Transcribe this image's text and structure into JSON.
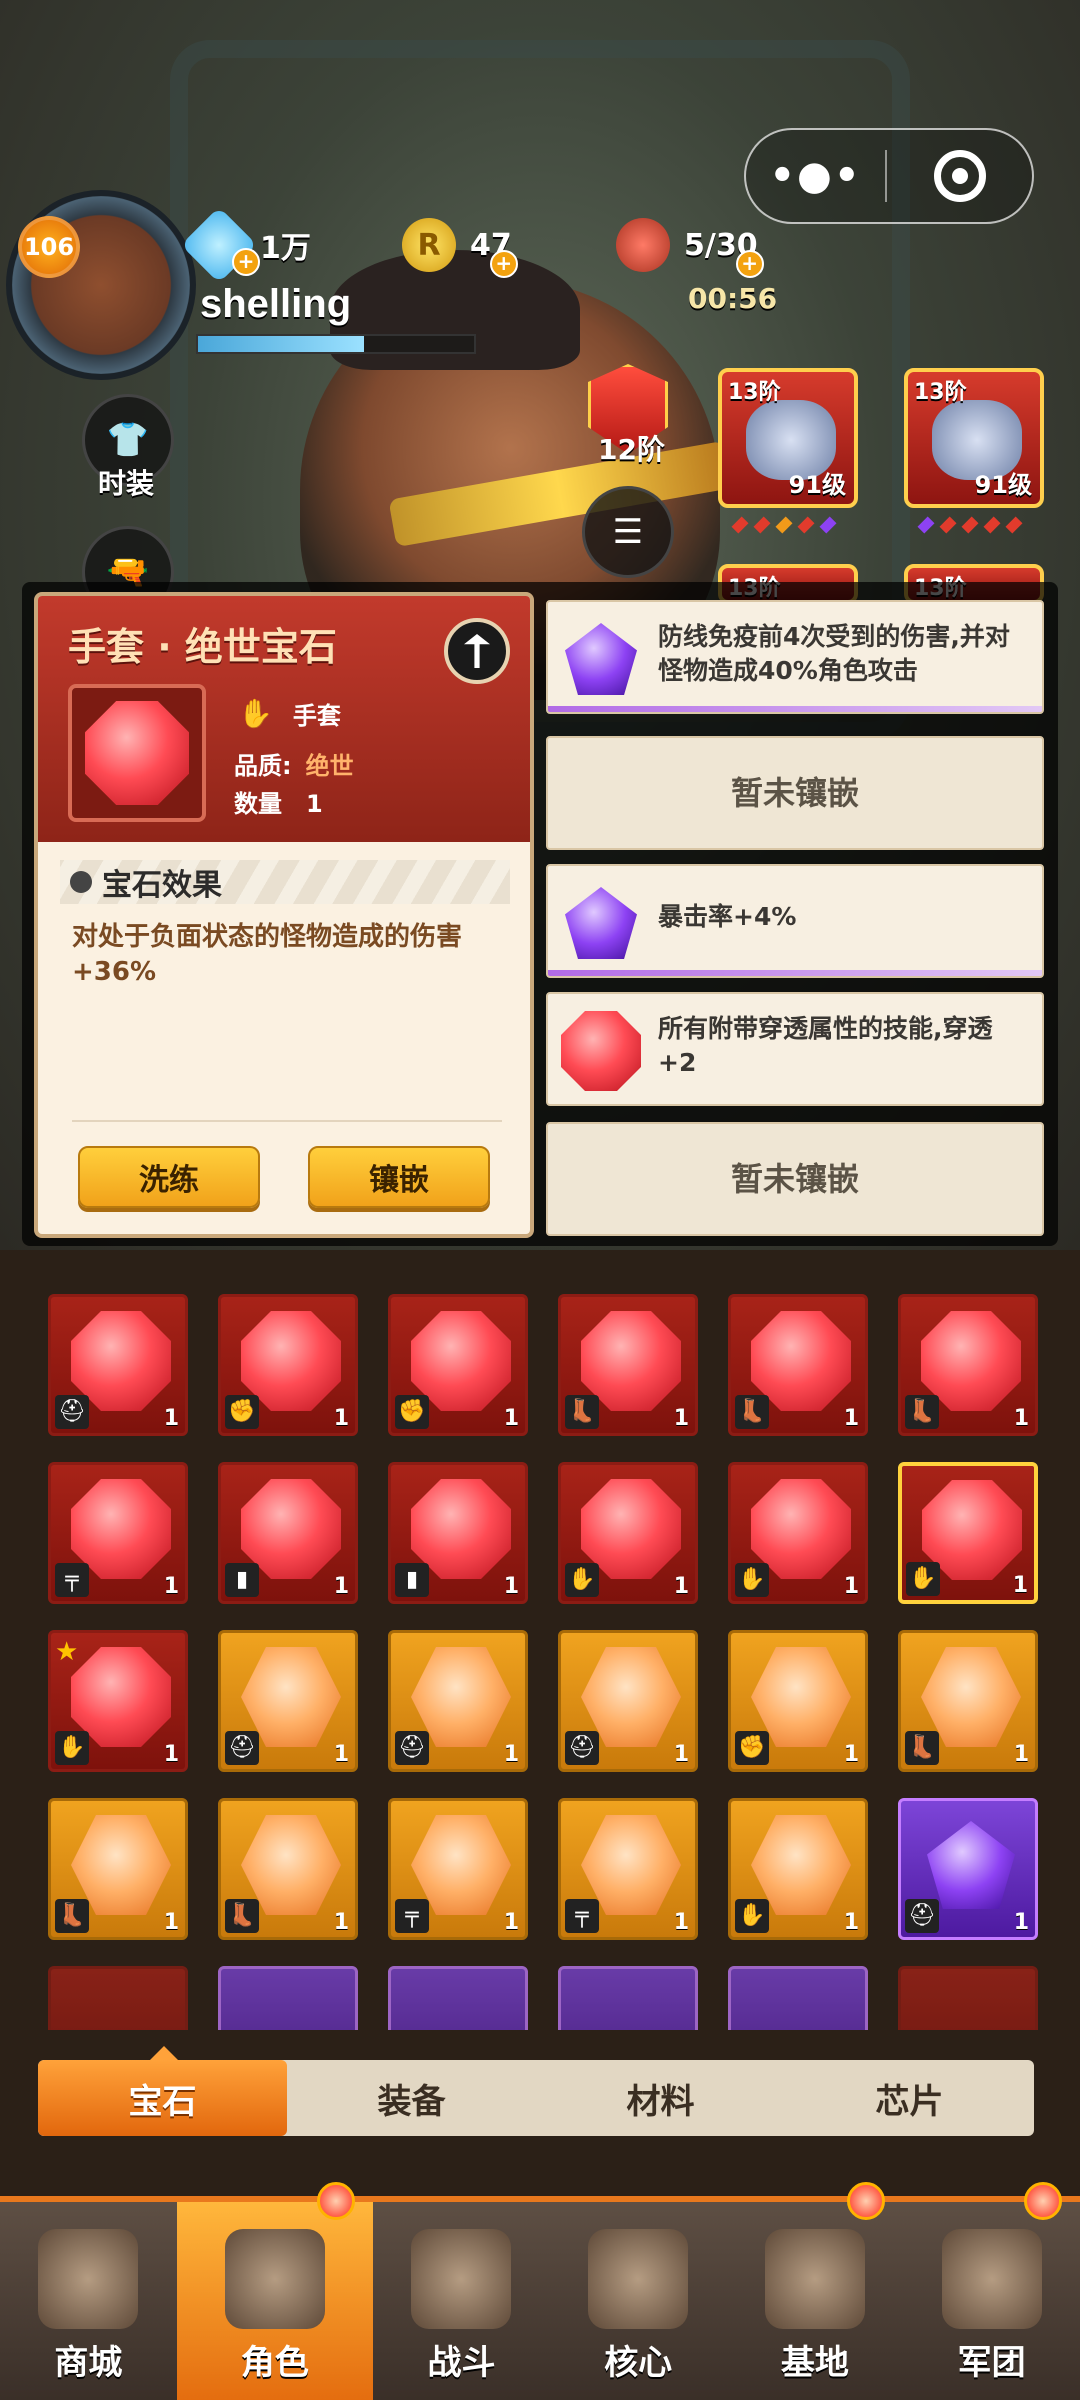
{
  "top": {
    "player_level": "106",
    "player_name": "shelling",
    "diamonds": "1万",
    "coins": "47",
    "coin_letter": "R",
    "stamina": "5/30",
    "timer": "00:56",
    "menu_dots": "•●•"
  },
  "side_buttons": [
    {
      "label": "时装",
      "icon": "shirt-icon"
    },
    {
      "label": "",
      "icon": "gun-icon"
    }
  ],
  "stage": {
    "label": "12阶",
    "gem_button_label": "宝石"
  },
  "equip": [
    {
      "tier": "13阶",
      "level": "91级",
      "icon": "helmet-icon"
    },
    {
      "tier": "13阶",
      "level": "91级",
      "icon": "gauntlet-icon"
    },
    {
      "tier": "13阶"
    },
    {
      "tier": "13阶"
    }
  ],
  "detail": {
    "title": "手套 · 绝世宝石",
    "slot_label": "手套",
    "quality_label": "品质:",
    "quality_value": "绝世",
    "count_label": "数量",
    "count_value": "1",
    "effect_header": "宝石效果",
    "effect_text": "对处于负面状态的怪物造成的伤害+36%",
    "btn_reroll": "洗练",
    "btn_inlay": "镶嵌"
  },
  "sockets": [
    {
      "type": "purple",
      "text": "防线免疫前4次受到的伤害,并对怪物造成40%角色攻击"
    },
    {
      "type": "empty",
      "text": "暂未镶嵌"
    },
    {
      "type": "purple",
      "text": "暴击率+4%"
    },
    {
      "type": "red",
      "text": "所有附带穿透属性的技能,穿透+2"
    },
    {
      "type": "empty",
      "text": "暂未镶嵌"
    }
  ],
  "inventory": [
    {
      "gem": "red",
      "slot": "helmet",
      "count": "1"
    },
    {
      "gem": "red",
      "slot": "gauntlet",
      "count": "1"
    },
    {
      "gem": "red",
      "slot": "gauntlet",
      "count": "1"
    },
    {
      "gem": "red",
      "slot": "boots",
      "count": "1"
    },
    {
      "gem": "red",
      "slot": "boots",
      "count": "1"
    },
    {
      "gem": "red",
      "slot": "boots",
      "count": "1"
    },
    {
      "gem": "red",
      "slot": "gun",
      "count": "1"
    },
    {
      "gem": "red",
      "slot": "pants",
      "count": "1"
    },
    {
      "gem": "red",
      "slot": "pants",
      "count": "1"
    },
    {
      "gem": "red",
      "slot": "glove",
      "count": "1"
    },
    {
      "gem": "red",
      "slot": "glove",
      "count": "1"
    },
    {
      "gem": "red",
      "slot": "glove",
      "count": "1",
      "selected": true
    },
    {
      "gem": "red",
      "slot": "glove",
      "count": "1",
      "star": true
    },
    {
      "gem": "orange",
      "slot": "helmet",
      "count": "1"
    },
    {
      "gem": "orange",
      "slot": "helmet",
      "count": "1"
    },
    {
      "gem": "orange",
      "slot": "helmet",
      "count": "1"
    },
    {
      "gem": "orange",
      "slot": "gauntlet",
      "count": "1"
    },
    {
      "gem": "orange",
      "slot": "boots",
      "count": "1"
    },
    {
      "gem": "orange",
      "slot": "boots",
      "count": "1"
    },
    {
      "gem": "orange",
      "slot": "boots",
      "count": "1"
    },
    {
      "gem": "orange",
      "slot": "gun",
      "count": "1"
    },
    {
      "gem": "orange",
      "slot": "gun",
      "count": "1"
    },
    {
      "gem": "orange",
      "slot": "glove",
      "count": "1"
    },
    {
      "gem": "purple",
      "slot": "helmet",
      "count": "1"
    }
  ],
  "tabs": [
    "宝石",
    "装备",
    "材料",
    "芯片"
  ],
  "nav": [
    {
      "label": "商城",
      "dot": false
    },
    {
      "label": "角色",
      "dot": true
    },
    {
      "label": "战斗",
      "dot": false
    },
    {
      "label": "核心",
      "dot": false
    },
    {
      "label": "基地",
      "dot": true
    },
    {
      "label": "军团",
      "dot": true
    }
  ],
  "colors": {
    "accent_orange": "#e9781d",
    "gem_red": "#ff4b54",
    "gem_purple": "#8d42f3",
    "gem_orange": "#ffb067",
    "quality_text": "#ffb36b"
  }
}
